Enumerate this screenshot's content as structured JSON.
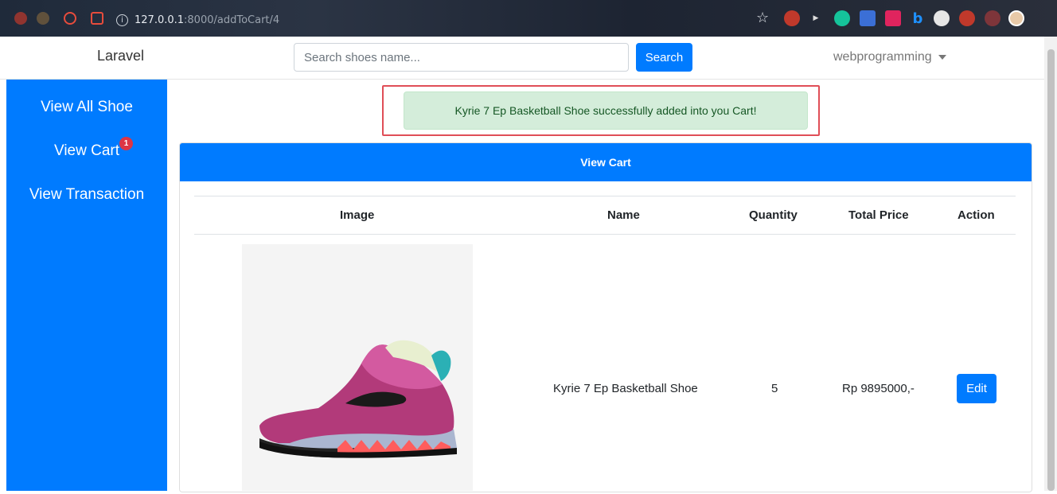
{
  "browser": {
    "url_host": "127.0.0.1",
    "url_rest": ":8000/addToCart/4"
  },
  "navbar": {
    "brand": "Laravel",
    "search_placeholder": "Search shoes name...",
    "search_button": "Search",
    "user_menu": "webprogramming"
  },
  "sidebar": {
    "items": [
      {
        "label": "View All Shoe"
      },
      {
        "label": "View Cart",
        "badge": "1"
      },
      {
        "label": "View Transaction"
      }
    ]
  },
  "alert": {
    "message": "Kyrie 7 Ep Basketball Shoe successfully added into you Cart!"
  },
  "cart": {
    "header": "View Cart",
    "columns": [
      "Image",
      "Name",
      "Quantity",
      "Total Price",
      "Action"
    ],
    "rows": [
      {
        "name": "Kyrie 7 Ep Basketball Shoe",
        "quantity": "5",
        "total_price": "Rp 9895000,-",
        "action": "Edit"
      }
    ]
  },
  "colors": {
    "primary": "#007bff",
    "alert_bg": "#d4edda",
    "alert_text": "#155724",
    "badge": "#dc3545",
    "highlight": "#e04e57"
  }
}
